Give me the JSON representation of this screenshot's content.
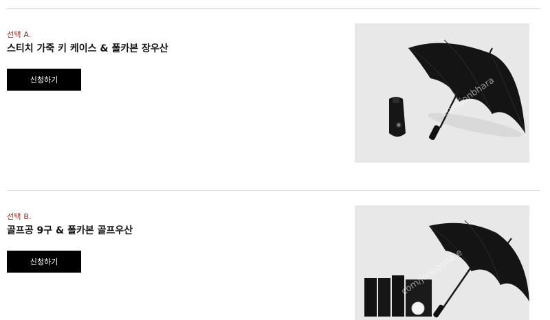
{
  "options": [
    {
      "label": "선택 A.",
      "title": "스티치 가죽 키 케이스 & 폴카본 장우산",
      "button_label": "신청하기",
      "image_watermark": "com/jonbhara"
    },
    {
      "label": "선택 B.",
      "title": "골프공 9구 & 폴카본 골프우산",
      "button_label": "신청하기",
      "image_watermark": "com/jonogona.e"
    }
  ],
  "colors": {
    "label_accent": "#8b2d1f",
    "button_bg": "#000000",
    "image_bg": "#e8e8e8",
    "divider": "#dcdcdc"
  }
}
